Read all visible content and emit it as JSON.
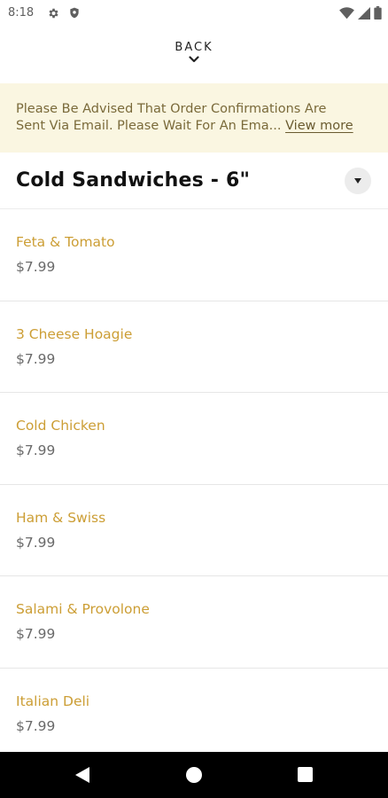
{
  "status_bar": {
    "time": "8:18",
    "icons": [
      "gear-icon",
      "shield-icon",
      "wifi-icon",
      "signal-icon",
      "battery-icon"
    ]
  },
  "header": {
    "back_label": "BACK",
    "back_icon": "chevron-down-icon"
  },
  "notice": {
    "line1": "Please Be Advised That Order Confirmations Are",
    "line2": "Sent Via Email. Please Wait For An Ema...",
    "view_more": "View more"
  },
  "category": {
    "title": "Cold Sandwiches - 6\"",
    "toggle_icon": "caret-down-icon"
  },
  "items": [
    {
      "name": "Feta & Tomato",
      "price": "$7.99"
    },
    {
      "name": "3 Cheese Hoagie",
      "price": "$7.99"
    },
    {
      "name": "Cold Chicken",
      "price": "$7.99"
    },
    {
      "name": "Ham & Swiss",
      "price": "$7.99"
    },
    {
      "name": "Salami & Provolone",
      "price": "$7.99"
    },
    {
      "name": "Italian Deli",
      "price": "$7.99"
    }
  ],
  "colors": {
    "accent": "#cc9e35",
    "notice_bg": "#faf6e1",
    "price": "#6a6a6a",
    "nav_bar": "#000000"
  },
  "nav_bar": {
    "icons": [
      "back-triangle-icon",
      "home-circle-icon",
      "recents-square-icon"
    ]
  }
}
